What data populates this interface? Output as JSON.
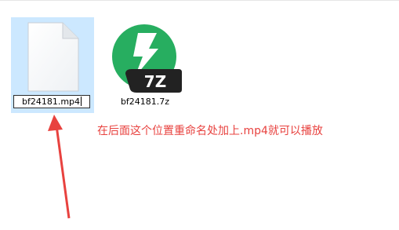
{
  "files": [
    {
      "name": "bf24181.mp4",
      "icon": "blank-document-icon",
      "state": "renaming",
      "selected": true
    },
    {
      "name": "bf24181.7z",
      "icon": "7zip-archive-icon",
      "badge": "7Z",
      "selected": false
    }
  ],
  "annotation": {
    "text": "在后面这个位置重命名处加上.mp4就可以播放",
    "arrow": "red-arrow-pointing-up"
  },
  "colors": {
    "selection": "#cce8ff",
    "annotation": "#e8423f",
    "archive_green": "#27ae60",
    "badge_dark": "#222222"
  }
}
